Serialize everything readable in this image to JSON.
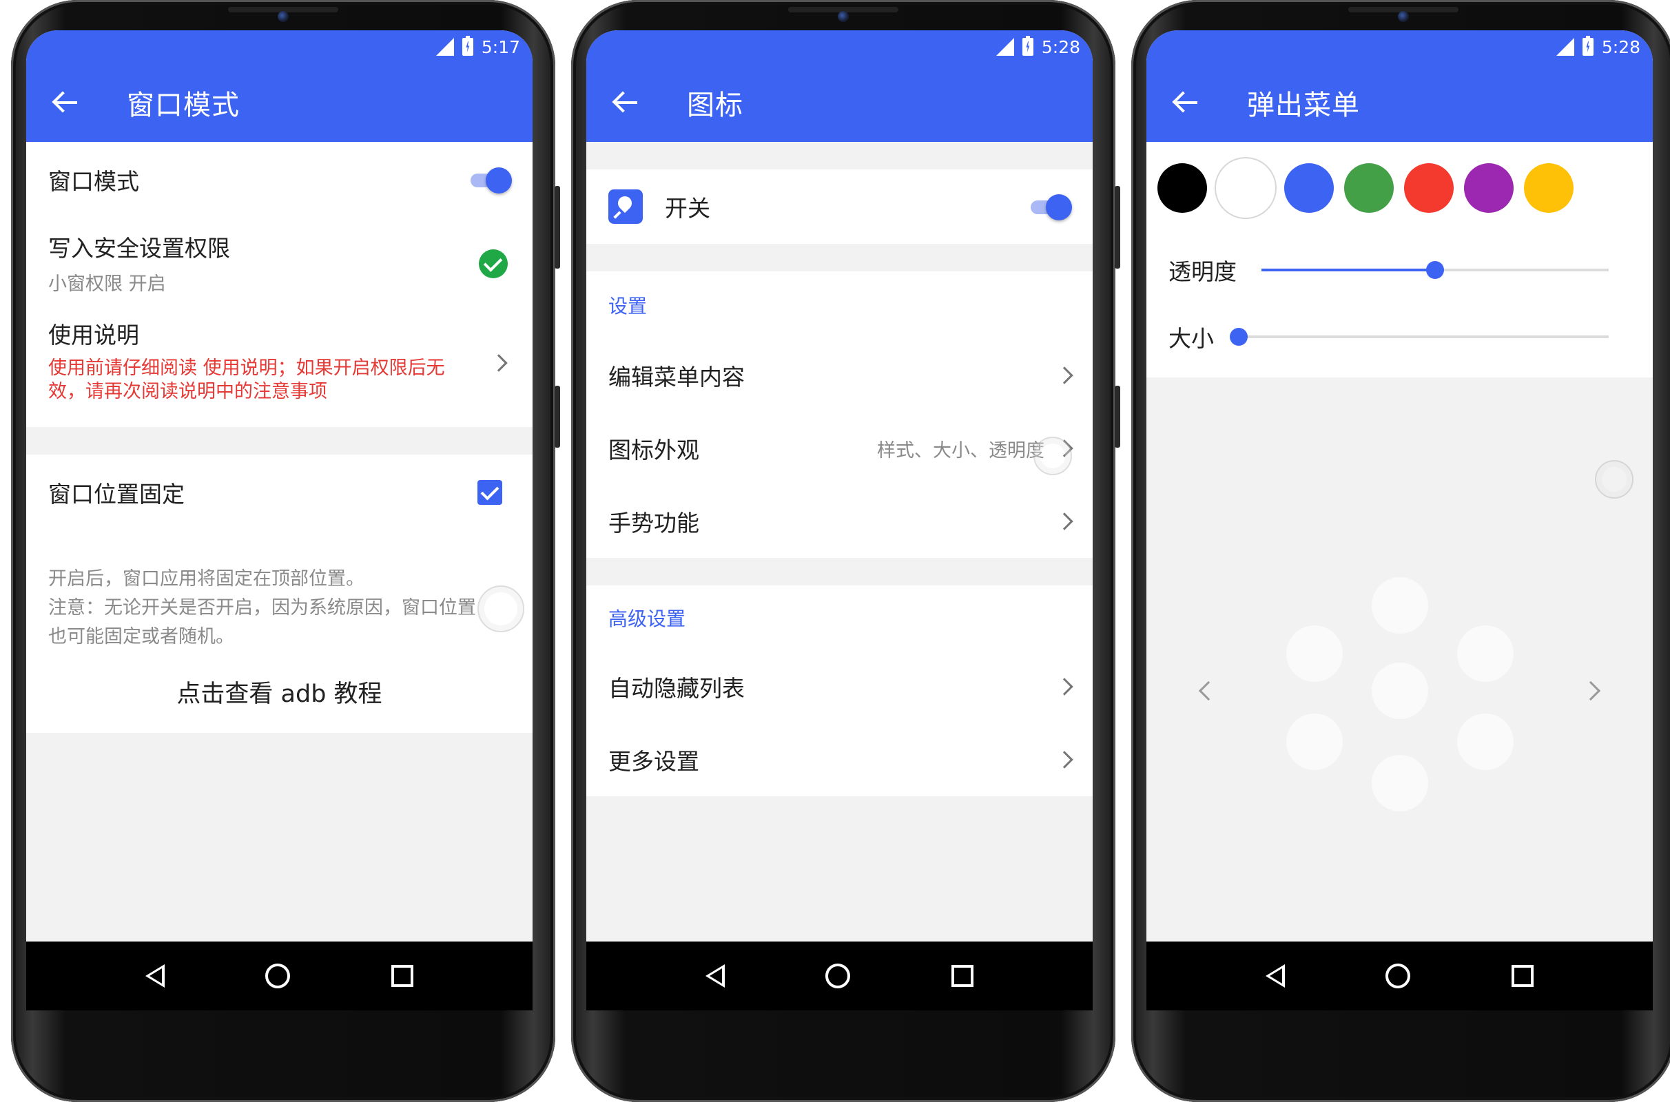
{
  "screens": [
    {
      "status_time": "5:17",
      "title": "窗口模式",
      "rows": [
        {
          "title": "窗口模式",
          "toggle": true
        },
        {
          "title": "写入安全设置权限",
          "subtitle": "小窗权限 开启",
          "check": true
        },
        {
          "title": "使用说明",
          "warning": "使用前请仔细阅读 使用说明；如果开启权限后无效，请再次阅读说明中的注意事项"
        }
      ],
      "fixed_row": {
        "title": "窗口位置固定",
        "checked": true
      },
      "note_lines": [
        "开启后，窗口应用将固定在顶部位置。",
        "注意：无论开关是否开启，因为系统原因，窗口位置",
        "也可能固定或者随机。"
      ],
      "link": "点击查看 adb 教程"
    },
    {
      "status_time": "5:28",
      "title": "图标",
      "switch_row": {
        "title": "开关",
        "icon": "pin-icon",
        "toggle": true
      },
      "section1": {
        "label": "设置",
        "items": [
          {
            "title": "编辑菜单内容"
          },
          {
            "title": "图标外观",
            "hint": "样式、大小、透明度"
          },
          {
            "title": "手势功能"
          }
        ]
      },
      "section2": {
        "label": "高级设置",
        "items": [
          {
            "title": "自动隐藏列表"
          },
          {
            "title": "更多设置"
          }
        ]
      }
    },
    {
      "status_time": "5:28",
      "title": "弹出菜单",
      "colors": [
        "#000000",
        "#ffffff",
        "#3d63f3",
        "#43a047",
        "#f4392f",
        "#9c27b0",
        "#ffc107"
      ],
      "selected_color": "#ffffff",
      "sliders": [
        {
          "label": "透明度",
          "value": 0.5
        },
        {
          "label": "大小",
          "value": 0.0
        }
      ]
    }
  ],
  "theme": {
    "primary": "#3d63f3",
    "warning": "#e53935",
    "success": "#1fa845"
  }
}
